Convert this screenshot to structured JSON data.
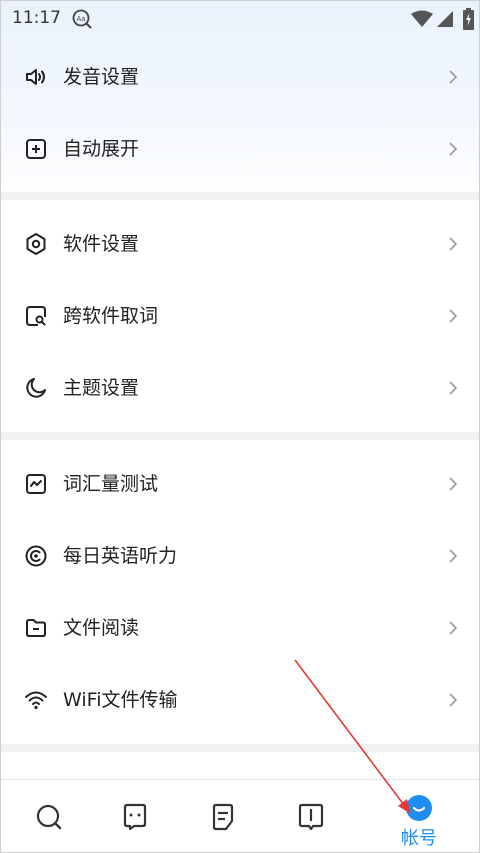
{
  "status_bar": {
    "time": "11:17"
  },
  "groups": [
    {
      "items": [
        {
          "label": "发音设置",
          "icon": "speaker-icon"
        },
        {
          "label": "自动展开",
          "icon": "plus-square-icon"
        }
      ]
    },
    {
      "items": [
        {
          "label": "软件设置",
          "icon": "hexagon-settings-icon"
        },
        {
          "label": "跨软件取词",
          "icon": "search-square-icon"
        },
        {
          "label": "主题设置",
          "icon": "moon-icon"
        }
      ]
    },
    {
      "items": [
        {
          "label": "词汇量测试",
          "icon": "chart-square-icon"
        },
        {
          "label": "每日英语听力",
          "icon": "headphone-circle-icon"
        },
        {
          "label": "文件阅读",
          "icon": "folder-icon"
        },
        {
          "label": "WiFi文件传输",
          "icon": "wifi-icon"
        }
      ]
    }
  ],
  "tabbar": {
    "tabs": [
      {
        "name": "search",
        "icon": "search-icon",
        "label": ""
      },
      {
        "name": "chat",
        "icon": "chat-face-icon",
        "label": ""
      },
      {
        "name": "notes",
        "icon": "note-icon",
        "label": ""
      },
      {
        "name": "book",
        "icon": "book-icon",
        "label": ""
      },
      {
        "name": "account",
        "icon": "account-icon",
        "label": "帐号",
        "active": true
      }
    ]
  },
  "colors": {
    "accent": "#1f8cf0",
    "annotation_arrow": "#e53935",
    "separator": "#f0f1f3"
  }
}
